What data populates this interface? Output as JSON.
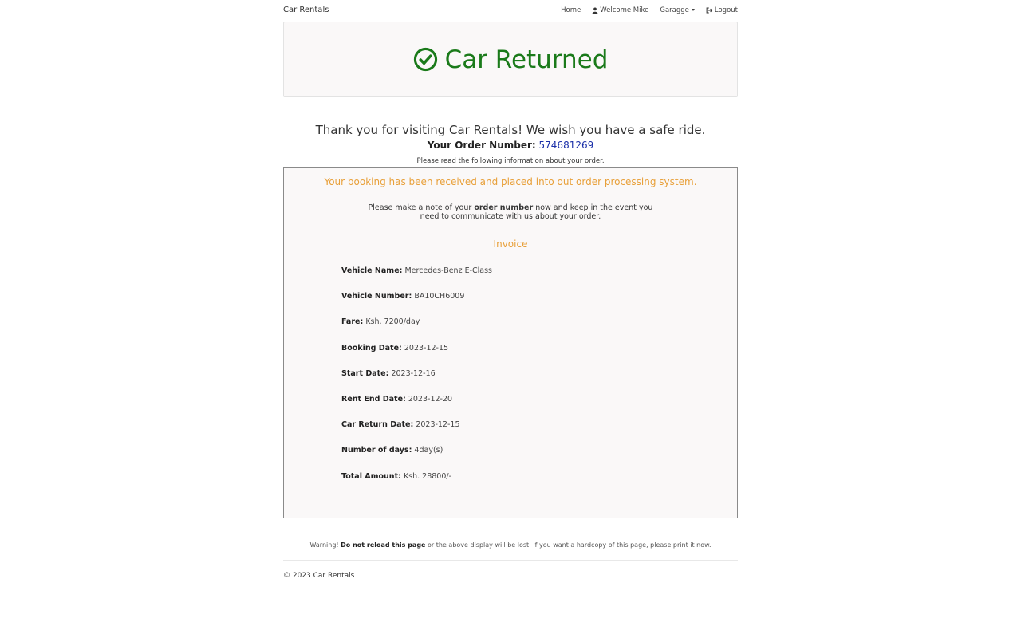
{
  "navbar": {
    "brand": "Car Rentals",
    "home": "Home",
    "welcome": "Welcome Mike",
    "garage": "Garagge",
    "logout": "Logout"
  },
  "jumbotron": {
    "title": "Car Returned",
    "color": "#1a7a1a"
  },
  "thanks": "Thank you for visiting Car Rentals! We wish you have a safe ride.",
  "order": {
    "label": "Your Order Number:",
    "number": "574681269"
  },
  "read_note": "Please read the following information about your order.",
  "panel": {
    "received": "Your booking has been received and placed into out order processing system.",
    "note_prefix": "Please make a note of your",
    "note_bold": "order number",
    "note_suffix": "now and keep in the event you need to communicate with us about your order.",
    "invoice_title": "Invoice",
    "details": [
      {
        "label": "Vehicle Name:",
        "value": "Mercedes-Benz E-Class"
      },
      {
        "label": "Vehicle Number:",
        "value": "BA10CH6009"
      },
      {
        "label": "Fare:",
        "value": " Ksh. 7200/day"
      },
      {
        "label": "Booking Date:",
        "value": "2023-12-15"
      },
      {
        "label": "Start Date:",
        "value": "2023-12-16"
      },
      {
        "label": "Rent End Date:",
        "value": "2023-12-20"
      },
      {
        "label": "Car Return Date:",
        "value": "2023-12-15"
      },
      {
        "label": "Number of days:",
        "value": "4day(s)"
      },
      {
        "label": "Total Amount:",
        "value": "Ksh. 28800/-"
      }
    ]
  },
  "warning": {
    "prefix": "Warning!",
    "bold": "Do not reload this page",
    "suffix": "or the above display will be lost. If you want a hardcopy of this page, please print it now."
  },
  "footer": "© 2023 Car Rentals"
}
